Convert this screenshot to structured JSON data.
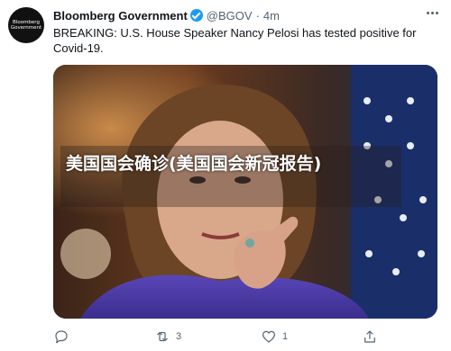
{
  "account": {
    "avatar_lines": [
      "Bloomberg",
      "Government"
    ],
    "display_name": "Bloomberg Government",
    "handle": "@BGOV",
    "separator": "·",
    "time": "4m"
  },
  "tweet": {
    "text": "BREAKING: U.S. House Speaker Nancy Pelosi has tested positive for Covid-19."
  },
  "media": {
    "overlay_caption": "美国国会确诊(美国国会新冠报告)"
  },
  "actions": {
    "reply_count": "",
    "retweet_count": "3",
    "like_count": "1"
  },
  "colors": {
    "verified": "#1d9bf0",
    "text_secondary": "#536471",
    "text_primary": "#0f1419"
  }
}
